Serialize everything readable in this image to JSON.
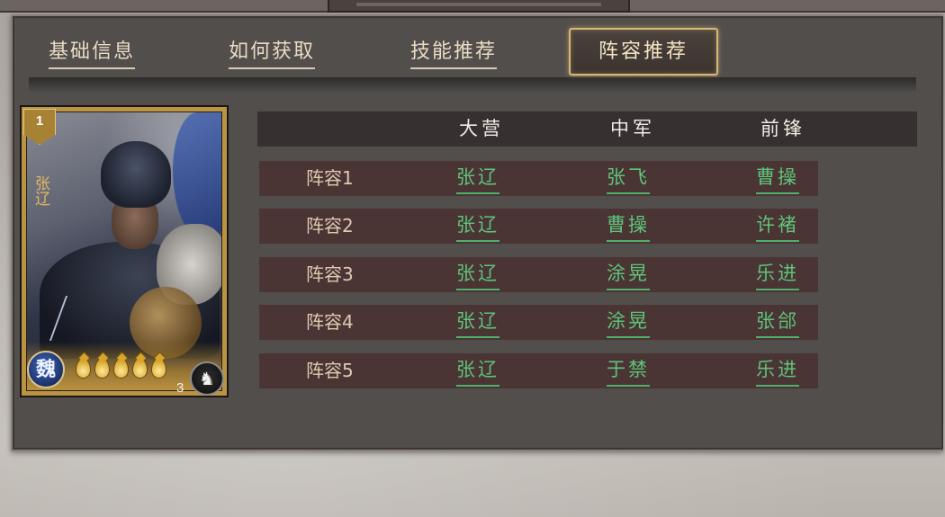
{
  "tabs": [
    {
      "label": "基础信息",
      "active": false
    },
    {
      "label": "如何获取",
      "active": false
    },
    {
      "label": "技能推荐",
      "active": false
    },
    {
      "label": "阵容推荐",
      "active": true
    }
  ],
  "card": {
    "rank": "1",
    "name": "张辽",
    "faction": "魏",
    "stars": 5,
    "cost": "3",
    "unit_icon": "cavalry-horse-icon"
  },
  "table": {
    "headers": [
      "大营",
      "中军",
      "前锋"
    ],
    "rows": [
      {
        "label": "阵容1",
        "dayin": "张辽",
        "zhongjun": "张飞",
        "qianfeng": "曹操"
      },
      {
        "label": "阵容2",
        "dayin": "张辽",
        "zhongjun": "曹操",
        "qianfeng": "许褚"
      },
      {
        "label": "阵容3",
        "dayin": "张辽",
        "zhongjun": "涂晃",
        "qianfeng": "乐进"
      },
      {
        "label": "阵容4",
        "dayin": "张辽",
        "zhongjun": "涂晃",
        "qianfeng": "张郃"
      },
      {
        "label": "阵容5",
        "dayin": "张辽",
        "zhongjun": "于禁",
        "qianfeng": "乐进"
      }
    ]
  },
  "colors": {
    "link_green": "#5dc47a",
    "active_tab_border": "#d6b679",
    "row_bg": "#4b3434"
  }
}
